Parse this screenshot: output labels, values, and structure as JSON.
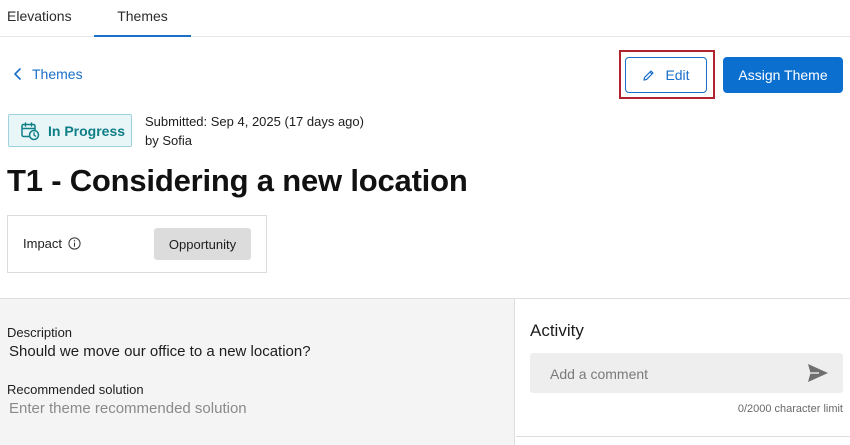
{
  "tabs": [
    {
      "label": "Elevations"
    },
    {
      "label": "Themes"
    }
  ],
  "back_link": {
    "label": "Themes"
  },
  "actions": {
    "edit_label": "Edit",
    "assign_label": "Assign Theme"
  },
  "status": {
    "label": "In Progress",
    "color": "#0e7e87"
  },
  "submitted": {
    "line1": "Submitted: Sep 4, 2025 (17 days ago)",
    "line2": "by Sofia"
  },
  "title": "T1 - Considering a new location",
  "impact": {
    "label": "Impact",
    "value": "Opportunity"
  },
  "description": {
    "label": "Description",
    "value": "Should we move our office to a new location?"
  },
  "recommended": {
    "label": "Recommended solution",
    "placeholder": "Enter theme recommended solution"
  },
  "activity": {
    "title": "Activity",
    "comment_placeholder": "Add a comment",
    "char_limit": "0/2000 character limit"
  },
  "colors": {
    "accent": "#1a6fc9",
    "primary_button": "#0b6fd0",
    "highlight_frame": "#b0222e"
  }
}
